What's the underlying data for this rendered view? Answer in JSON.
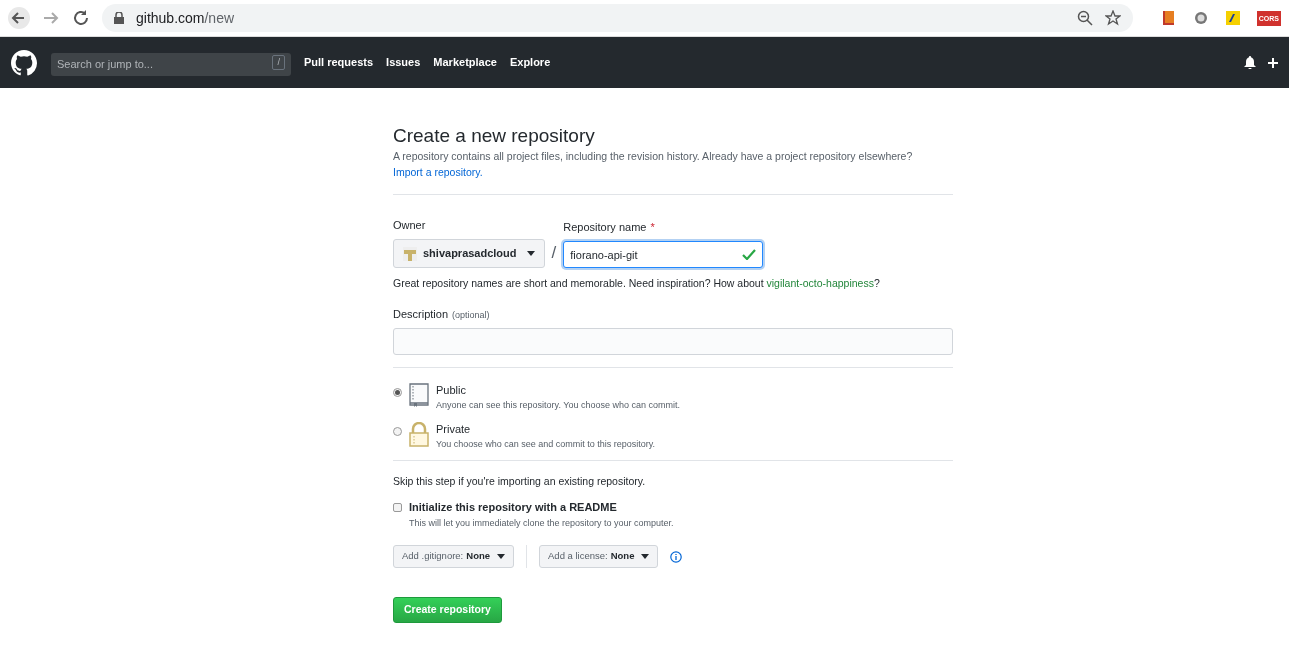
{
  "browser": {
    "url_host": "github.com",
    "url_path": "/new",
    "extensions": [
      {
        "kind": "book"
      },
      {
        "kind": "circle"
      },
      {
        "kind": "note"
      },
      {
        "kind": "text",
        "label": "CORS"
      }
    ]
  },
  "nav": {
    "search_placeholder": "Search or jump to...",
    "search_key": "/",
    "links": [
      "Pull requests",
      "Issues",
      "Marketplace",
      "Explore"
    ]
  },
  "form": {
    "title": "Create a new repository",
    "intro": "A repository contains all project files, including the revision history. Already have a project repository elsewhere?",
    "import_link": "Import a repository.",
    "owner_label": "Owner",
    "owner": "shivaprasadcloud",
    "separator": "/",
    "name_label": "Repository name",
    "required_mark": "*",
    "name_value": "fiorano-api-git",
    "name_valid": true,
    "hint": "Great repository names are short and memorable. Need inspiration? How about ",
    "suggestion": "vigilant-octo-happiness",
    "hint_end": "?",
    "description_label": "Description",
    "description_optional": "(optional)",
    "visibility": [
      {
        "kind": "public",
        "label": "Public",
        "note": "Anyone can see this repository. You choose who can commit.",
        "selected": true
      },
      {
        "kind": "private",
        "label": "Private",
        "note": "You choose who can see and commit to this repository.",
        "selected": false
      }
    ],
    "skip_note": "Skip this step if you're importing an existing repository.",
    "readme": {
      "label": "Initialize this repository with a README",
      "note": "This will let you immediately clone the repository to your computer.",
      "checked": false
    },
    "gitignore": {
      "label": "Add .gitignore:",
      "value": "None"
    },
    "license": {
      "label": "Add a license:",
      "value": "None"
    },
    "submit": "Create repository"
  }
}
